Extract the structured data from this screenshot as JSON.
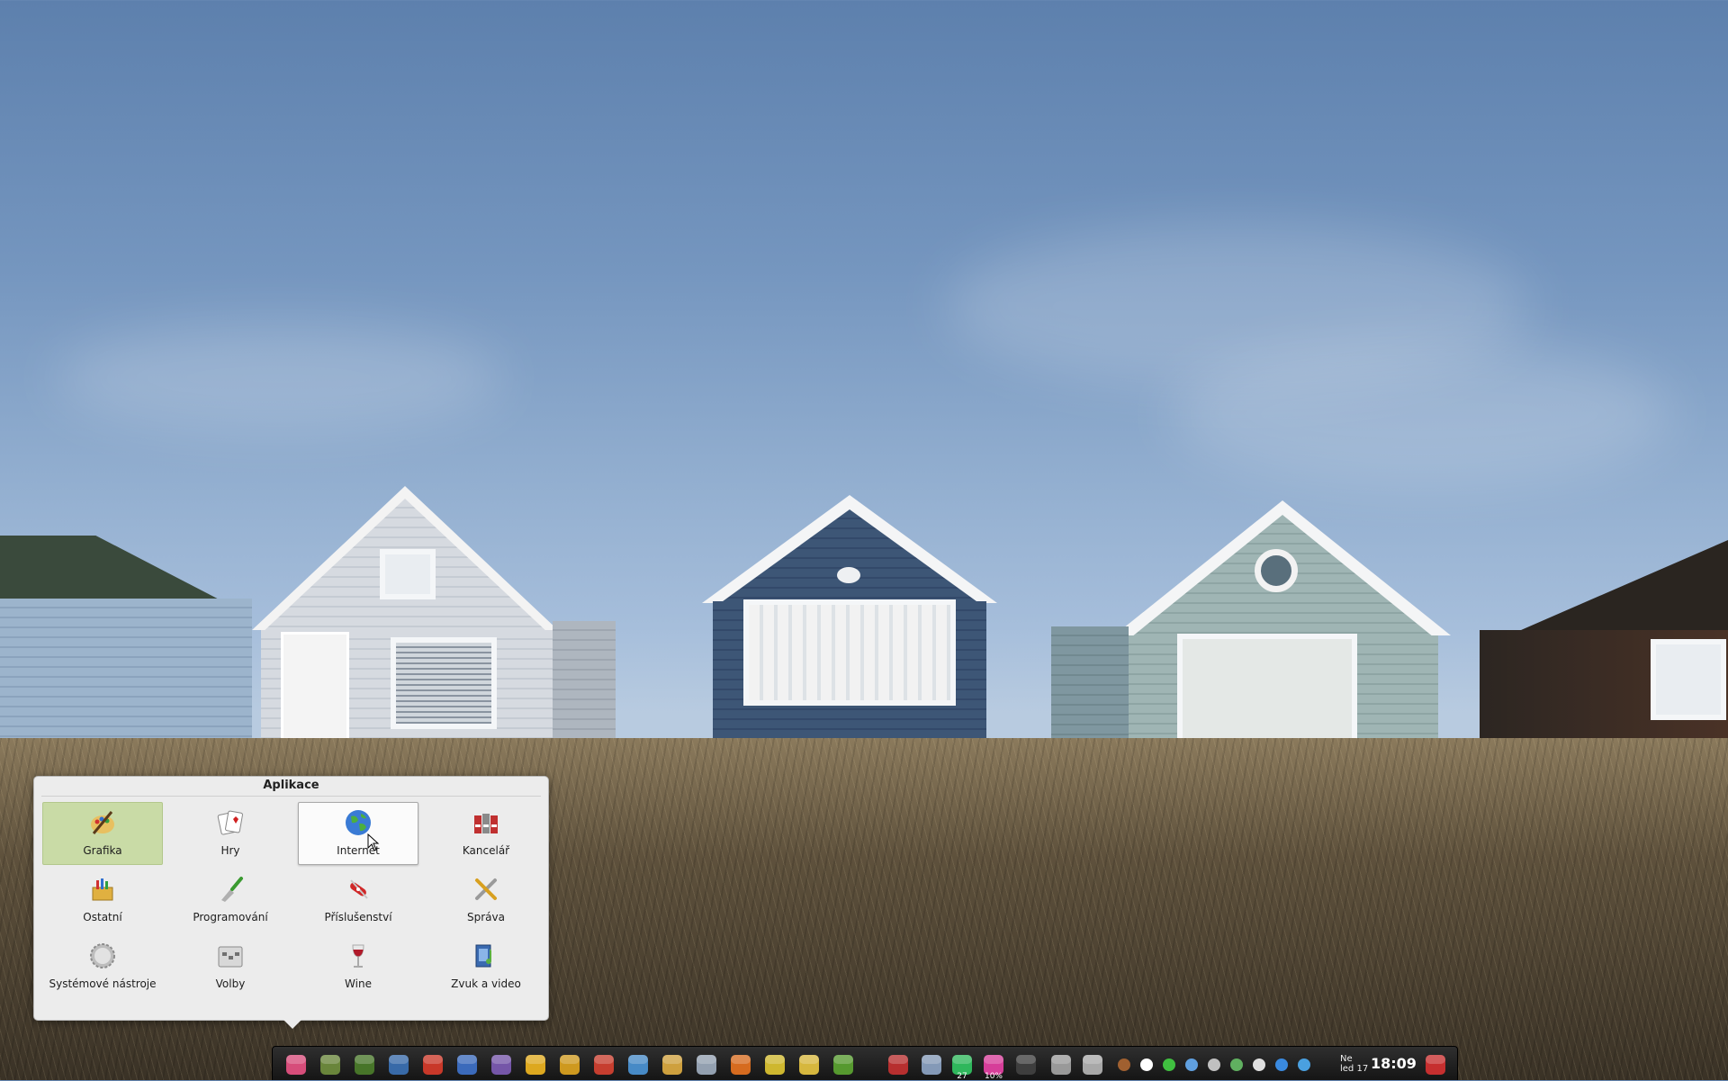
{
  "menu": {
    "title": "Aplikace",
    "categories": [
      {
        "label": "Grafika",
        "icon": "graphics-icon",
        "state": "selected"
      },
      {
        "label": "Hry",
        "icon": "games-icon",
        "state": "normal"
      },
      {
        "label": "Internet",
        "icon": "internet-globe-icon",
        "state": "hover"
      },
      {
        "label": "Kancelář",
        "icon": "office-icon",
        "state": "normal"
      },
      {
        "label": "Ostatní",
        "icon": "other-icon",
        "state": "normal"
      },
      {
        "label": "Programování",
        "icon": "programming-icon",
        "state": "normal"
      },
      {
        "label": "Příslušenství",
        "icon": "accessories-icon",
        "state": "normal"
      },
      {
        "label": "Správa",
        "icon": "administration-icon",
        "state": "normal"
      },
      {
        "label": "Systémové nástroje",
        "icon": "system-tools-icon",
        "state": "normal"
      },
      {
        "label": "Volby",
        "icon": "preferences-icon",
        "state": "normal"
      },
      {
        "label": "Wine",
        "icon": "wine-glass-icon",
        "state": "normal"
      },
      {
        "label": "Zvuk a video",
        "icon": "sound-video-icon",
        "state": "normal"
      }
    ]
  },
  "dock": {
    "launchers": [
      {
        "name": "applications-menu-icon",
        "color": "#e05080"
      },
      {
        "name": "file-manager-icon",
        "color": "#6e8b3d"
      },
      {
        "name": "system-monitor-icon",
        "color": "#4a7a2a"
      },
      {
        "name": "browser-icon",
        "color": "#3a6fb0"
      },
      {
        "name": "gmail-icon",
        "color": "#d23a2a"
      },
      {
        "name": "download-icon",
        "color": "#3d6fc4"
      },
      {
        "name": "chat-icon",
        "color": "#7a5ab0"
      },
      {
        "name": "chrome-icon",
        "color": "#e8b020"
      },
      {
        "name": "archive-icon",
        "color": "#d8a020"
      },
      {
        "name": "picasa-icon",
        "color": "#d04030"
      },
      {
        "name": "note-icon",
        "color": "#4a90d0"
      },
      {
        "name": "package-icon",
        "color": "#d8a840"
      },
      {
        "name": "mail-icon",
        "color": "#9aa8b8"
      },
      {
        "name": "burner-icon",
        "color": "#e07020"
      },
      {
        "name": "music-icon",
        "color": "#d8c030"
      },
      {
        "name": "cooking-icon",
        "color": "#e0c040"
      },
      {
        "name": "software-center-icon",
        "color": "#5aa030"
      }
    ],
    "applets": [
      {
        "name": "keyboard-flag-icon",
        "color": "#c03030"
      },
      {
        "name": "weather-icon",
        "color": "#8aa0c0"
      },
      {
        "name": "cpu-gauge-icon",
        "color": "#30c060",
        "value": "27"
      },
      {
        "name": "cpu-graph-icon",
        "color": "#e040a0",
        "value": "10%"
      },
      {
        "name": "terminal-icon",
        "color": "#404040"
      },
      {
        "name": "usb-drive-icon",
        "color": "#a0a0a0"
      },
      {
        "name": "trash-icon",
        "color": "#b0b0b0"
      }
    ],
    "tray": [
      {
        "name": "gnome-foot-icon",
        "color": "#a06030"
      },
      {
        "name": "notification-icon",
        "color": "#ffffff"
      },
      {
        "name": "wifi-icon",
        "color": "#40c040"
      },
      {
        "name": "network-bars-icon",
        "color": "#60a0e0"
      },
      {
        "name": "volume-icon",
        "color": "#c0c0c0"
      },
      {
        "name": "screenshot-icon",
        "color": "#60b060"
      },
      {
        "name": "clipboard-icon",
        "color": "#e0e0e0"
      },
      {
        "name": "dropbox-icon",
        "color": "#3a8ae0"
      },
      {
        "name": "update-icon",
        "color": "#4aa0e0"
      }
    ],
    "clock": {
      "day": "Ne",
      "date": "led 17",
      "time": "18:09"
    },
    "logout": {
      "name": "logout-icon",
      "color": "#d03030"
    }
  }
}
